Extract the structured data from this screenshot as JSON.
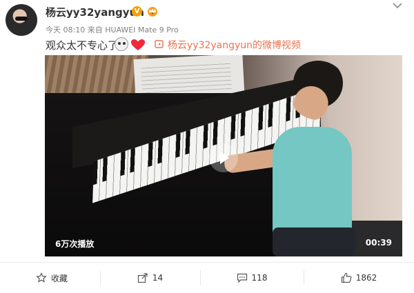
{
  "post": {
    "username": "杨云yy32yangyun",
    "verified_badge": "V",
    "meta": "今天 08:10 来自 HUAWEI Mate 9 Pro",
    "text": "观众太不专心了",
    "video_link_text": "杨云yy32yangyun的微博视频"
  },
  "video": {
    "views": "6万次播放",
    "duration": "00:39"
  },
  "actions": {
    "favorite_label": "收藏",
    "repost_count": "14",
    "comment_count": "118",
    "like_count": "1862"
  },
  "colors": {
    "link": "#eb7350",
    "badge": "#f6a000",
    "heart": "#f0293c"
  },
  "icons": [
    "chevron-down-icon",
    "crown-icon",
    "emoji-icon",
    "heart-icon",
    "video-icon",
    "play-icon",
    "star-icon",
    "share-icon",
    "comment-icon",
    "like-icon"
  ]
}
